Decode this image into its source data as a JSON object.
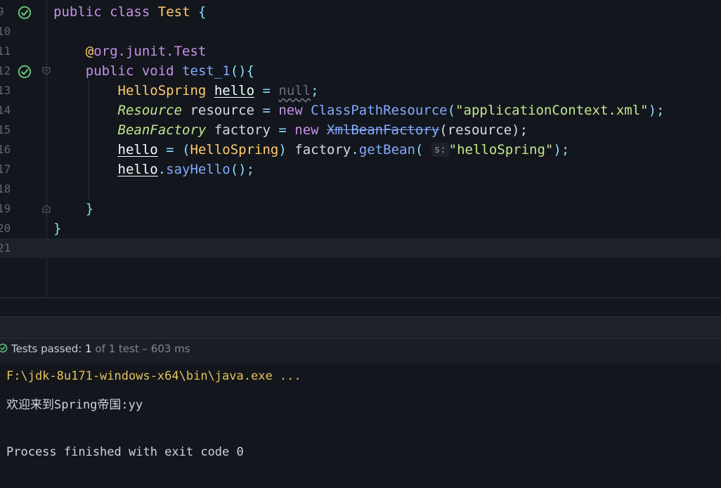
{
  "editor": {
    "lines": [
      {
        "n": "9"
      },
      {
        "n": "10"
      },
      {
        "n": "11"
      },
      {
        "n": "12"
      },
      {
        "n": "13"
      },
      {
        "n": "14"
      },
      {
        "n": "15"
      },
      {
        "n": "16"
      },
      {
        "n": "17"
      },
      {
        "n": "18"
      },
      {
        "n": "19"
      },
      {
        "n": "20"
      },
      {
        "n": "21"
      }
    ],
    "code": {
      "l9": {
        "kw1": "public",
        "kw2": "class",
        "cls": "Test",
        "brace": "{"
      },
      "l11": {
        "at": "@",
        "ann": "org.junit.Test"
      },
      "l12": {
        "kw1": "public",
        "kw2": "void",
        "fn": "test_1",
        "tail": "(){"
      },
      "l13": {
        "type": "HelloSpring",
        "var": "hello",
        "eq": "=",
        "nul": "null",
        "semi": ";"
      },
      "l14": {
        "type": "Resource",
        "var": "resource",
        "eq": "=",
        "kw": "new",
        "fn": "ClassPathResource",
        "open": "(",
        "str": "\"applicationContext.xml\"",
        "close": ");"
      },
      "l15": {
        "type": "BeanFactory",
        "var": "factory",
        "eq": "=",
        "kw": "new",
        "fn": "XmlBeanFactory",
        "args": "(resource);"
      },
      "l16": {
        "var": "hello",
        "eq": "=",
        "open": "(",
        "cast": "HelloSpring",
        "close": ")",
        "obj": "factory",
        "dot": ".",
        "fn": "getBean",
        "paren": "(",
        "hint": "s:",
        "str": "\"helloSpring\"",
        "end": ");"
      },
      "l17": {
        "var": "hello",
        "dot": ".",
        "fn": "sayHello",
        "end": "();"
      },
      "l19": {
        "brace": "}"
      },
      "l20": {
        "brace": "}"
      }
    }
  },
  "status": {
    "label": "Tests passed:",
    "count": "1",
    "rest": "of 1 test – 603 ms"
  },
  "console": {
    "cmd": "F:\\jdk-8u171-windows-x64\\bin\\java.exe ...",
    "output": "欢迎来到Spring帝国:yy",
    "exit": "Process finished with exit code 0"
  },
  "colors": {
    "background": "#13161c",
    "keyword": "#c792ea",
    "class": "#ffcb6b",
    "function": "#82aaff",
    "string": "#c3e88d",
    "pass_icon": "#62c27a"
  },
  "icons": {
    "run_test": "check-circle-icon",
    "fold": "fold-marker-icon",
    "passed": "check-icon"
  }
}
